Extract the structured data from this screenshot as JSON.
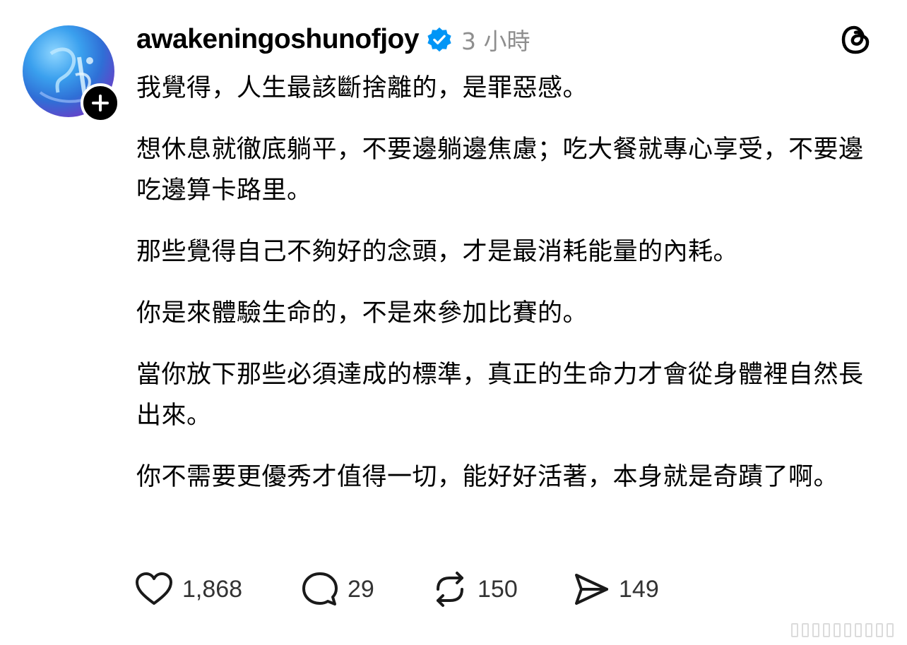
{
  "post": {
    "username": "awakeningoshunofjoy",
    "timestamp": "3 小時",
    "paragraphs": [
      "我覺得，人生最該斷捨離的，是罪惡感。",
      "想休息就徹底躺平，不要邊躺邊焦慮；吃大餐就專心享受，不要邊吃邊算卡路里。",
      "那些覺得自己不夠好的念頭，才是最消耗能量的內耗。",
      "你是來體驗生命的，不是來參加比賽的。",
      "當你放下那些必須達成的標準，真正的生命力才會從身體裡自然長出來。",
      "你不需要更優秀才值得一切，能好好活著，本身就是奇蹟了啊。"
    ]
  },
  "actions": {
    "likes": "1,868",
    "replies": "29",
    "reposts": "150",
    "shares": "149"
  },
  "icons": {
    "avatar": "avatar-image",
    "follow": "plus-icon",
    "verified": "verified-badge-icon",
    "app_logo": "threads-logo-icon",
    "like": "heart-icon",
    "reply": "comment-bubble-icon",
    "repost": "repost-icon",
    "share": "send-icon"
  },
  "colors": {
    "verified": "#0095f6",
    "timestamp": "#8e8e8e",
    "text": "#000000"
  }
}
